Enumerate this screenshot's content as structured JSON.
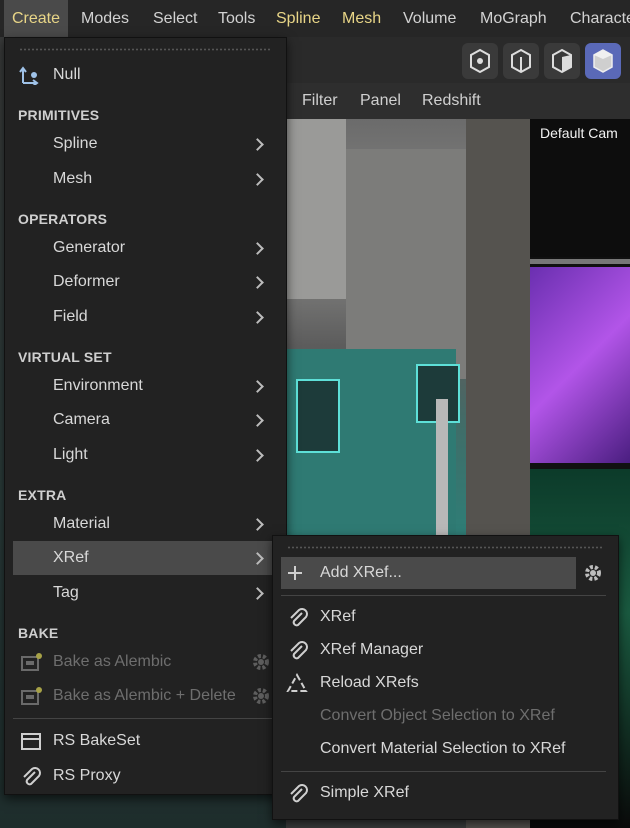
{
  "menubar": {
    "items": [
      "Create",
      "Modes",
      "Select",
      "Tools",
      "Spline",
      "Mesh",
      "Volume",
      "MoGraph",
      "Characte"
    ]
  },
  "subbar": {
    "items": [
      "Filter",
      "Panel",
      "Redshift"
    ]
  },
  "viewport": {
    "camera_label": "Default Cam"
  },
  "create_menu": {
    "null_label": "Null",
    "sections": {
      "primitives": "PRIMITIVES",
      "operators": "OPERATORS",
      "virtual_set": "VIRTUAL SET",
      "extra": "EXTRA",
      "bake": "BAKE"
    },
    "items": {
      "spline": "Spline",
      "mesh": "Mesh",
      "generator": "Generator",
      "deformer": "Deformer",
      "field": "Field",
      "environment": "Environment",
      "camera": "Camera",
      "light": "Light",
      "material": "Material",
      "xref": "XRef",
      "tag": "Tag",
      "bake_alembic": "Bake as Alembic",
      "bake_alembic_delete": "Bake as Alembic + Delete",
      "rs_bakeset": "RS BakeSet",
      "rs_proxy": "RS Proxy"
    }
  },
  "xref_menu": {
    "add_xref": "Add XRef...",
    "xref": "XRef",
    "xref_manager": "XRef Manager",
    "reload_xrefs": "Reload XRefs",
    "convert_object": "Convert Object Selection to XRef",
    "convert_material": "Convert Material Selection to XRef",
    "simple_xref": "Simple XRef"
  },
  "colors": {
    "accent_yellow": "#e8d587",
    "selected_blue": "#5a69b8",
    "hover_gray": "#4a4a4a"
  }
}
